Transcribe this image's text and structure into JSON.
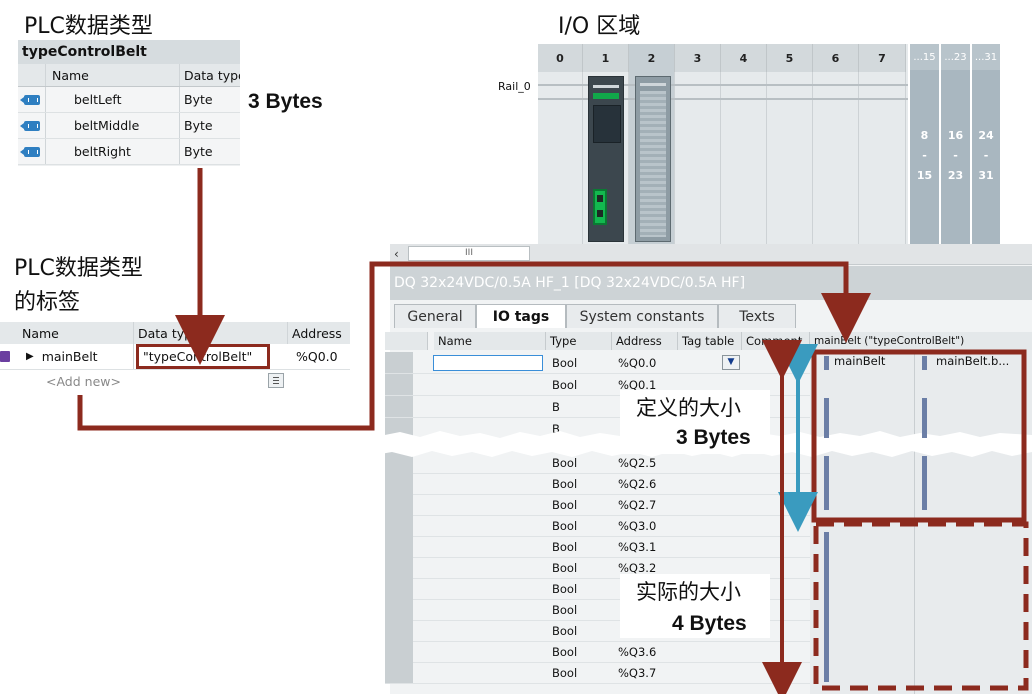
{
  "top_left": {
    "heading": "PLC数据类型",
    "udt_name": "typeControlBelt",
    "columns": [
      "Name",
      "Data type"
    ],
    "rows": [
      {
        "name": "beltLeft",
        "type": "Byte"
      },
      {
        "name": "beltMiddle",
        "type": "Byte"
      },
      {
        "name": "beltRight",
        "type": "Byte"
      }
    ],
    "size_note": "3 Bytes"
  },
  "left_tag": {
    "heading_line1": "PLC数据类型",
    "heading_line2": "的标签",
    "columns": [
      "Name",
      "Data typ",
      "Address"
    ],
    "row": {
      "name": "mainBelt",
      "type": "\"typeControlBelt\"",
      "address": "%Q0.0"
    },
    "add_new": "<Add new>"
  },
  "io_area": {
    "heading": "I/O 区域",
    "rail_label": "Rail_0",
    "slots": [
      "0",
      "1",
      "2",
      "3",
      "4",
      "5",
      "6",
      "7"
    ],
    "ext_headers": [
      "...15",
      "...23",
      "...31"
    ],
    "ext_ranges": [
      {
        "from": "8",
        "sep": "-",
        "to": "15"
      },
      {
        "from": "16",
        "sep": "-",
        "to": "23"
      },
      {
        "from": "24",
        "sep": "-",
        "to": "31"
      }
    ],
    "scroll_mark": "III"
  },
  "module": {
    "title": "DQ 32x24VDC/0.5A HF_1 [DQ 32x24VDC/0.5A HF]",
    "tabs": [
      "General",
      "IO tags",
      "System constants",
      "Texts"
    ],
    "active_tab": "IO tags",
    "columns": [
      "Name",
      "Type",
      "Address",
      "Tag table",
      "Comment"
    ],
    "struct_header": "mainBelt (\"typeControlBelt\")",
    "struct_sub": [
      "mainBelt",
      "mainBelt.b..."
    ],
    "rows_top": [
      {
        "type": "Bool",
        "address": "%Q0.0"
      },
      {
        "type": "Bool",
        "address": "%Q0.1"
      },
      {
        "type": "B",
        "address": ""
      },
      {
        "type": "B",
        "address": ""
      }
    ],
    "rows_bottom": [
      {
        "type": "Bool",
        "address": "%Q2.5"
      },
      {
        "type": "Bool",
        "address": "%Q2.6"
      },
      {
        "type": "Bool",
        "address": "%Q2.7"
      },
      {
        "type": "Bool",
        "address": "%Q3.0"
      },
      {
        "type": "Bool",
        "address": "%Q3.1"
      },
      {
        "type": "Bool",
        "address": "%Q3.2"
      },
      {
        "type": "Bool",
        "address": ""
      },
      {
        "type": "Bool",
        "address": ""
      },
      {
        "type": "Bool",
        "address": ""
      },
      {
        "type": "Bool",
        "address": "%Q3.6"
      },
      {
        "type": "Bool",
        "address": "%Q3.7"
      }
    ],
    "defined_label": "定义的大小",
    "defined_size": "3 Bytes",
    "actual_label": "实际的大小",
    "actual_size": "4 Bytes"
  },
  "colors": {
    "arrow_red": "#8c2a1e",
    "arrow_blue": "#3a9bbf",
    "tag_blue": "#2f7fc1",
    "struct_bar": "#6b7ea6"
  }
}
